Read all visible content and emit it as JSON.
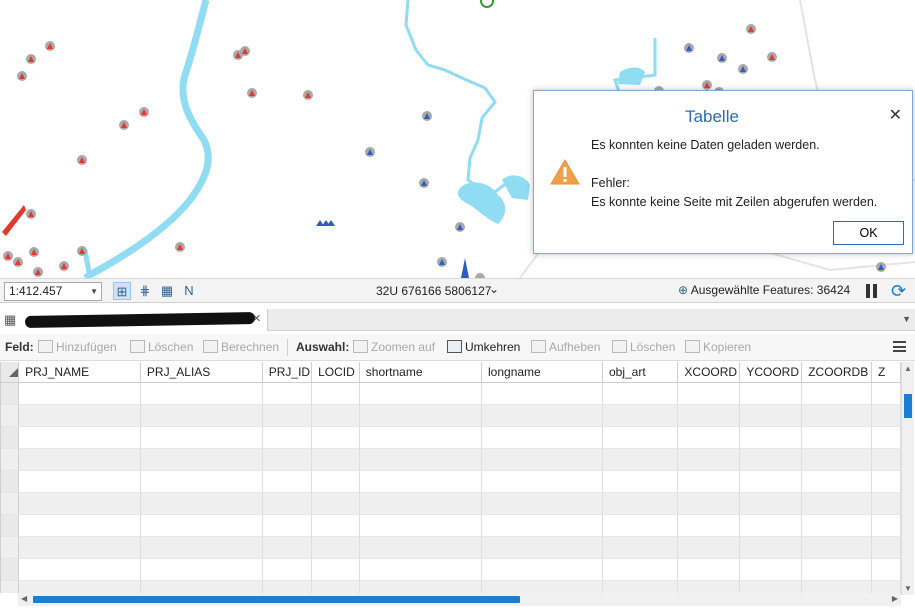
{
  "statusbar": {
    "scale": "1:412.457",
    "coordinates": "32U 676166 5806127",
    "selected_features": "Ausgewählte Features: 36424"
  },
  "table_toolbar": {
    "feld_label": "Feld:",
    "add_label": "Hinzufügen",
    "delete_field_label": "Löschen",
    "calculate_label": "Berechnen",
    "selection_label": "Auswahl:",
    "zoom_label": "Zoomen auf",
    "switch_label": "Umkehren",
    "clear_label": "Aufheben",
    "delete_sel_label": "Löschen",
    "copy_label": "Kopieren"
  },
  "table": {
    "columns": [
      "PRJ_NAME",
      "PRJ_ALIAS",
      "PRJ_ID",
      "LOCID",
      "shortname",
      "longname",
      "obj_art",
      "XCOORD",
      "YCOORD",
      "ZCOORDB",
      "Z"
    ]
  },
  "dialog": {
    "title": "Tabelle",
    "message": "Es konnten keine Daten geladen werden.",
    "error_label": "Fehler:",
    "error_detail": "Es konnte keine Seite mit Zeilen abgerufen werden.",
    "ok_label": "OK"
  },
  "colors": {
    "water": "#8fdcf3",
    "marker_red": "#e03a2f",
    "marker_blue": "#2f5fb8",
    "marker_bg": "#a9a9a9",
    "accent": "#1a7fd4"
  }
}
